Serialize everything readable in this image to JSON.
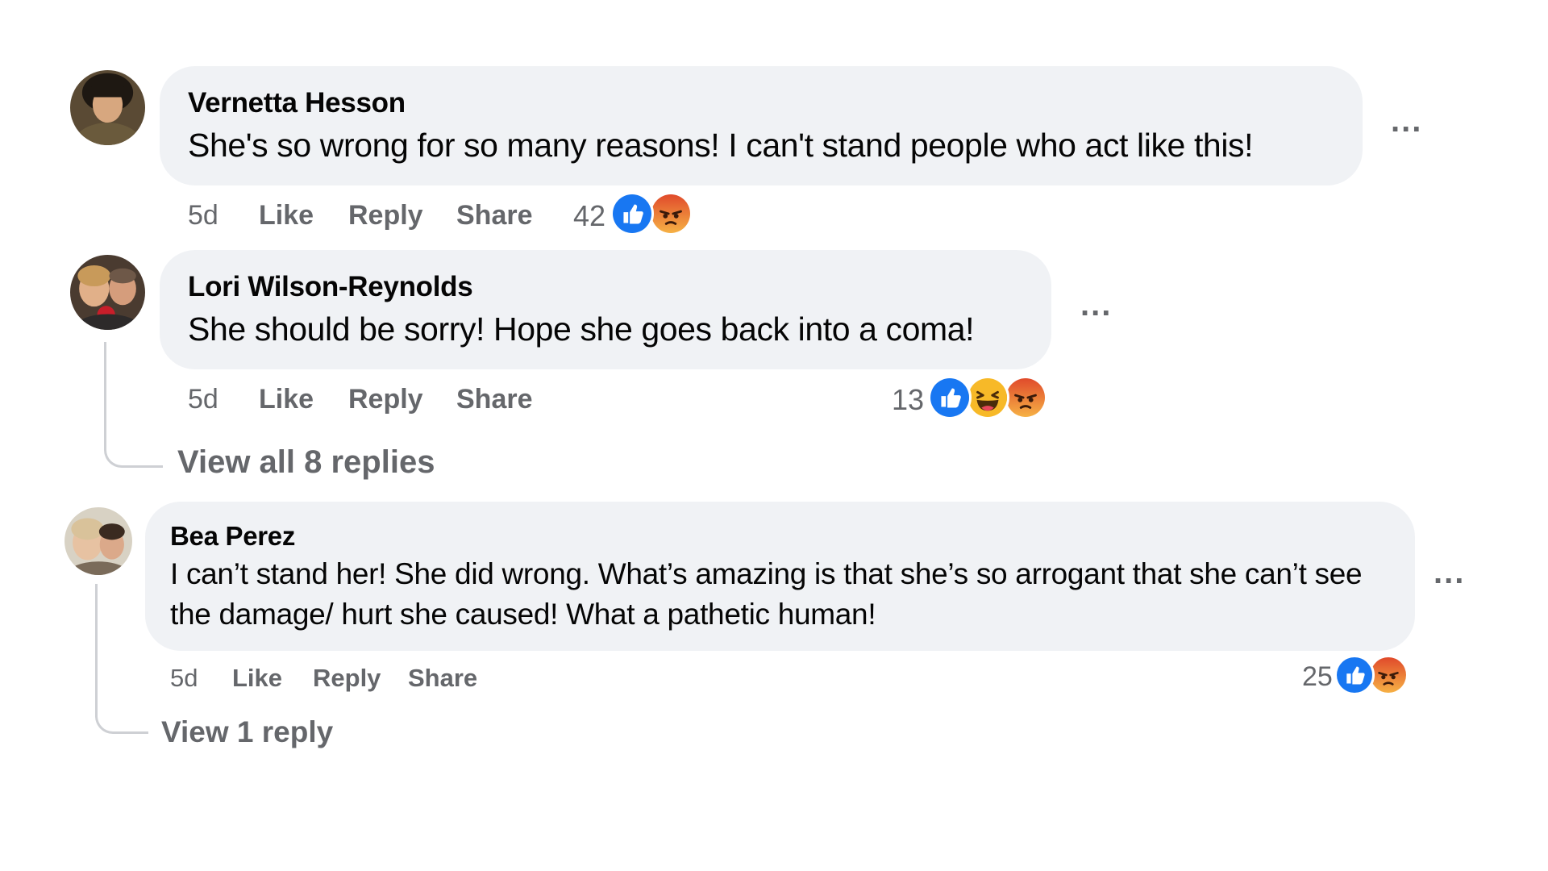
{
  "comments": [
    {
      "author": "Vernetta Hesson",
      "text": "She's so wrong for so many reasons! I can't stand people who act like this!",
      "time": "5d",
      "like_label": "Like",
      "reply_label": "Reply",
      "share_label": "Share",
      "reaction_count": "42",
      "reactions": [
        "like-icon",
        "angry-icon"
      ],
      "more_label": "..."
    },
    {
      "author": "Lori Wilson-Reynolds",
      "text": "She should be sorry! Hope she goes back into a coma!",
      "time": "5d",
      "like_label": "Like",
      "reply_label": "Reply",
      "share_label": "Share",
      "reaction_count": "13",
      "reactions": [
        "like-icon",
        "haha-icon",
        "angry-icon"
      ],
      "more_label": "...",
      "view_replies": "View all 8 replies"
    },
    {
      "author": "Bea Perez",
      "text": "I can’t stand her! She did wrong. What’s amazing is that she’s so arrogant that she can’t see the damage/ hurt she caused! What a pathetic human!",
      "time": "5d",
      "like_label": "Like",
      "reply_label": "Reply",
      "share_label": "Share",
      "reaction_count": "25",
      "reactions": [
        "like-icon",
        "angry-icon"
      ],
      "more_label": "...",
      "view_replies": "View 1 reply"
    }
  ],
  "colors": {
    "bubble": "#f0f2f5",
    "secondary_text": "#65676b",
    "like_blue": "#1877f2",
    "angry_orange": "#e9572f",
    "haha_yellow": "#f7b928"
  }
}
